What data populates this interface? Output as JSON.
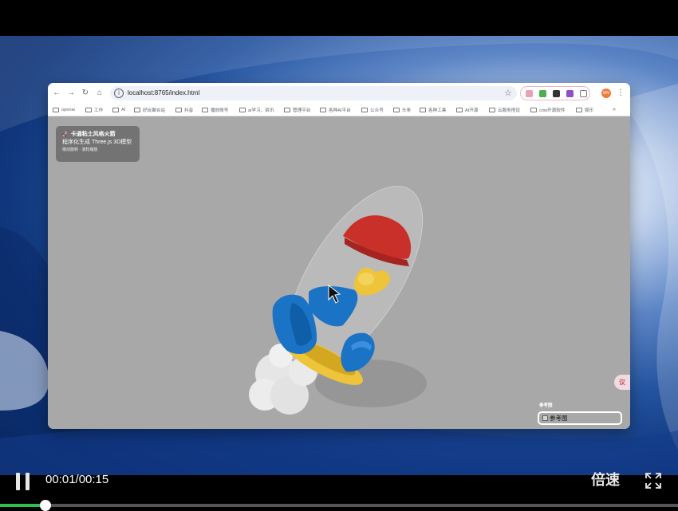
{
  "browser": {
    "url": "localhost:8765/index.html",
    "bookmarks": [
      "openai",
      "工作",
      "AI",
      "好玩聚合站",
      "抖音",
      "播放账号",
      "ai学习、资讯",
      "管理平台",
      "各种AI平台",
      "公众号",
      "头条",
      "各种工具",
      "AI开源",
      "云服务搭设",
      "cow开源软件",
      "娱乐"
    ],
    "bookmarks_more": "»",
    "profile_initials": "MN"
  },
  "scene_panel": {
    "title": "🚀 卡通粘土风格火箭",
    "subtitle": "程序化生成 Three.js 3D模型",
    "hint": "拖动旋转 · 滚轮缩放"
  },
  "reference": {
    "label": "参考图",
    "image_alt": "参考图"
  },
  "side_badge": "议",
  "player": {
    "time": "00:01/00:15",
    "speed_label": "倍速",
    "progress": 0.0667
  },
  "colors": {
    "rocket_red": "#c9302a",
    "rocket_blue": "#1b73c6",
    "rocket_yellow": "#edc43a",
    "smoke": "#e6e6e6",
    "progress": "#2fbf4f"
  }
}
